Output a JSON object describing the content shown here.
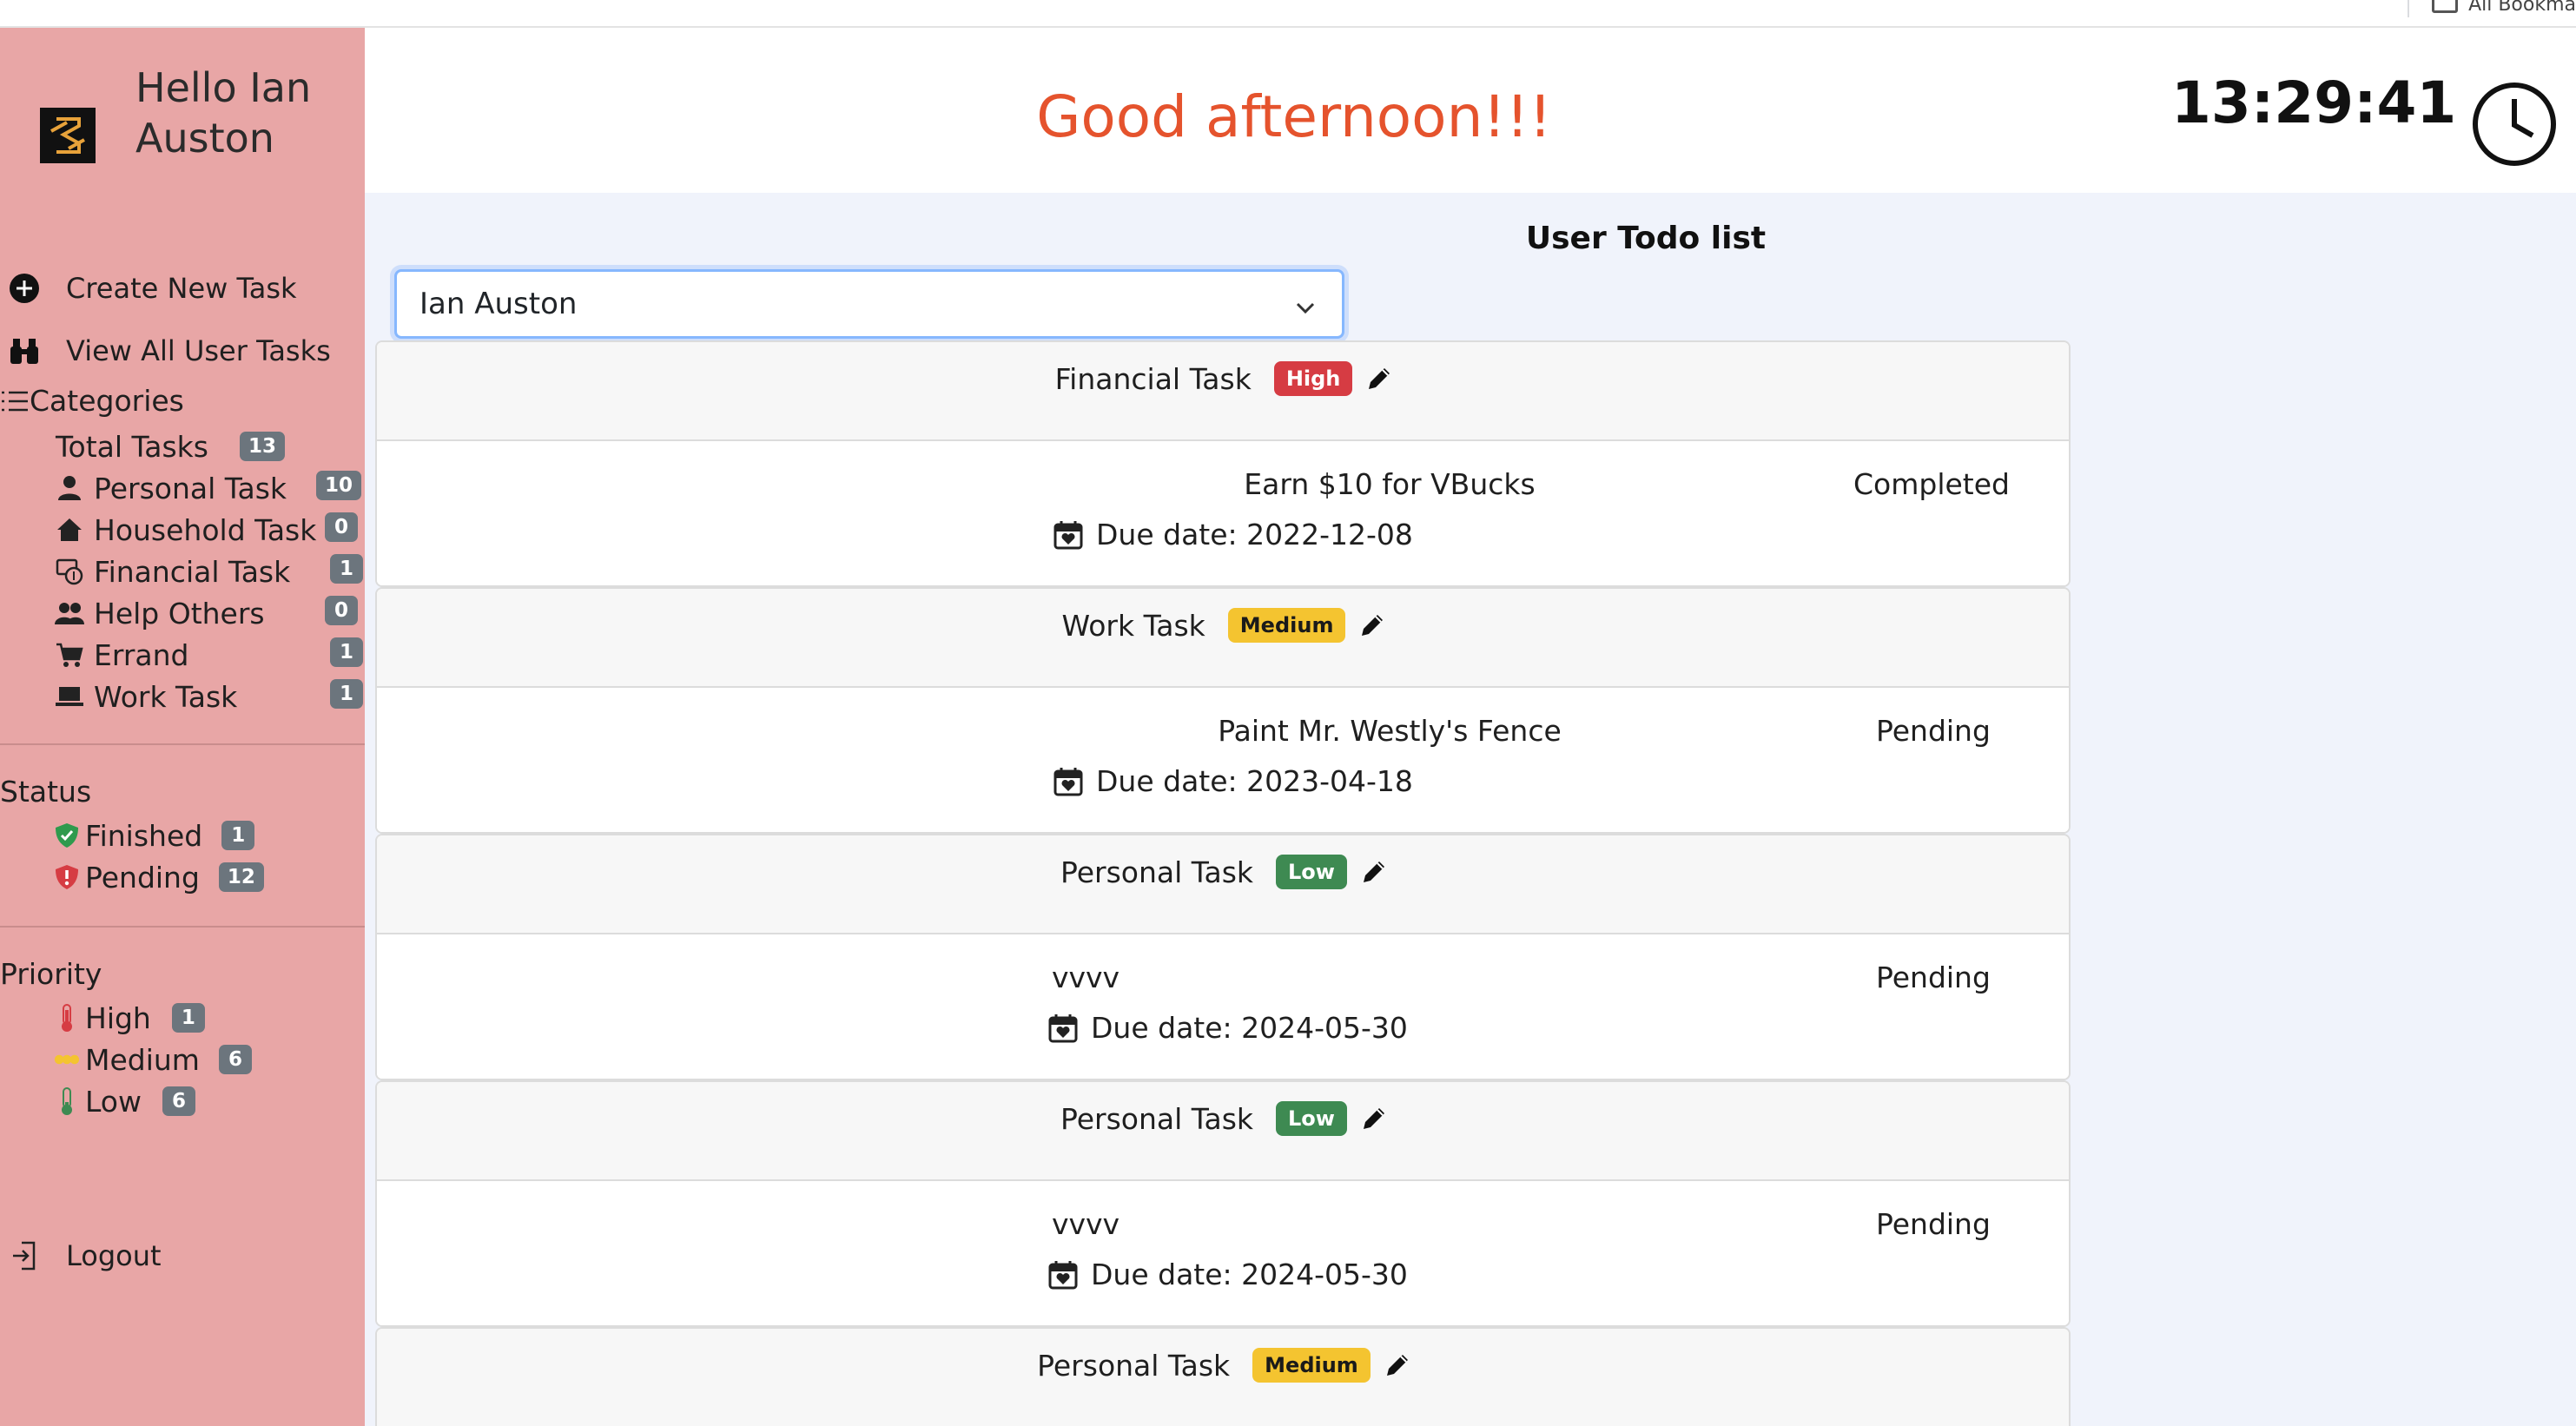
{
  "browser": {
    "bookmarks_label": "All Bookma"
  },
  "sidebar": {
    "greeting_line1": "Hello Ian",
    "greeting_line2": "Auston",
    "actions": [
      {
        "label": "Create New Task",
        "icon": "plus-circle-icon"
      },
      {
        "label": "View All User Tasks",
        "icon": "binoculars-icon"
      }
    ],
    "categories": {
      "title": "Categories",
      "total_label": "Total Tasks",
      "total_count": "13",
      "items": [
        {
          "label": "Personal Task",
          "count": "10",
          "icon": "person-icon"
        },
        {
          "label": "Household Task",
          "count": "0",
          "icon": "house-icon"
        },
        {
          "label": "Financial Task",
          "count": "1",
          "icon": "cash-icon"
        },
        {
          "label": "Help Others",
          "count": "0",
          "icon": "people-icon"
        },
        {
          "label": "Errand",
          "count": "1",
          "icon": "cart-icon"
        },
        {
          "label": "Work Task",
          "count": "1",
          "icon": "laptop-icon"
        }
      ]
    },
    "status": {
      "title": "Status",
      "items": [
        {
          "label": "Finished",
          "count": "1"
        },
        {
          "label": "Pending",
          "count": "12"
        }
      ]
    },
    "priority": {
      "title": "Priority",
      "items": [
        {
          "label": "High",
          "count": "1"
        },
        {
          "label": "Medium",
          "count": "6"
        },
        {
          "label": "Low",
          "count": "6"
        }
      ]
    },
    "logout_label": "Logout"
  },
  "header": {
    "greeting": "Good afternoon!!!",
    "time": "13:29:41"
  },
  "main": {
    "title": "User Todo list",
    "selected_user": "Ian Auston",
    "tasks": [
      {
        "category": "Financial Task",
        "priority": "High",
        "name": "Earn $10 for VBucks",
        "status": "Completed",
        "due": "Due date: 2022-12-08"
      },
      {
        "category": "Work Task",
        "priority": "Medium",
        "name": "Paint Mr. Westly's Fence",
        "status": "Pending",
        "due": "Due date: 2023-04-18"
      },
      {
        "category": "Personal Task",
        "priority": "Low",
        "name": "vvvv",
        "status": "Pending",
        "due": "Due date: 2024-05-30"
      },
      {
        "category": "Personal Task",
        "priority": "Low",
        "name": "vvvv",
        "status": "Pending",
        "due": "Due date: 2024-05-30"
      },
      {
        "category": "Personal Task",
        "priority": "Medium"
      }
    ]
  },
  "colors": {
    "sidebar_bg": "#e8a6a6",
    "greeting": "#e5532d",
    "badge_high": "#d63c43",
    "badge_medium": "#f4c430",
    "badge_low": "#3e8a52",
    "main_bg": "#f0f3fb"
  }
}
